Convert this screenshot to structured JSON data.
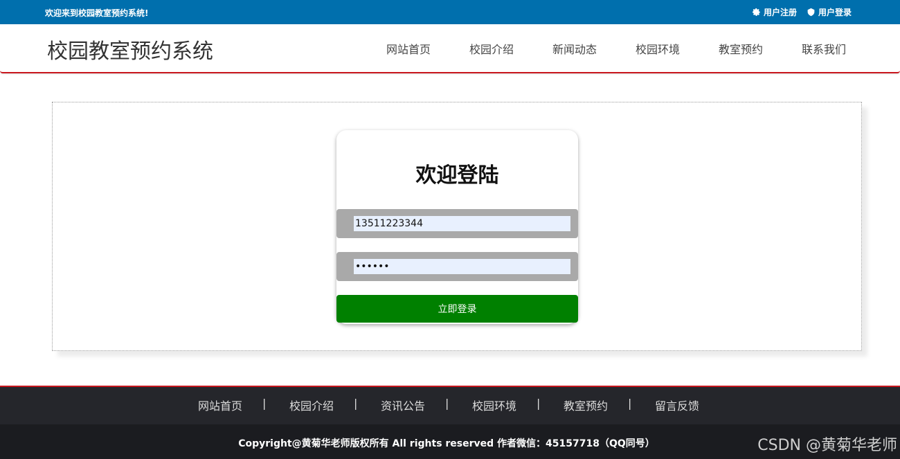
{
  "topbar": {
    "welcome": "欢迎来到校园教室预约系统!",
    "register": "用户注册",
    "login": "用户登录",
    "register_icon": "gear-icon",
    "login_icon": "user-icon"
  },
  "header": {
    "site_title": "校园教室预约系统",
    "nav": [
      "网站首页",
      "校园介绍",
      "新闻动态",
      "校园环境",
      "教室预约",
      "联系我们"
    ]
  },
  "login_card": {
    "title": "欢迎登陆",
    "username_value": "13511223344",
    "password_value": "••••••",
    "submit_label": "立即登录"
  },
  "footer": {
    "nav": [
      "网站首页",
      "校园介绍",
      "资讯公告",
      "校园环境",
      "教室预约",
      "留言反馈"
    ],
    "separator": "|",
    "copyright": "Copyright@黄菊华老师版权所有 All rights reserved 作者微信：45157718（QQ同号）"
  },
  "watermark": "CSDN @黄菊华老师",
  "colors": {
    "topbar": "#006fad",
    "accent_red": "#c8161d",
    "login_button": "#008000",
    "footer_dark": "#25262b"
  }
}
